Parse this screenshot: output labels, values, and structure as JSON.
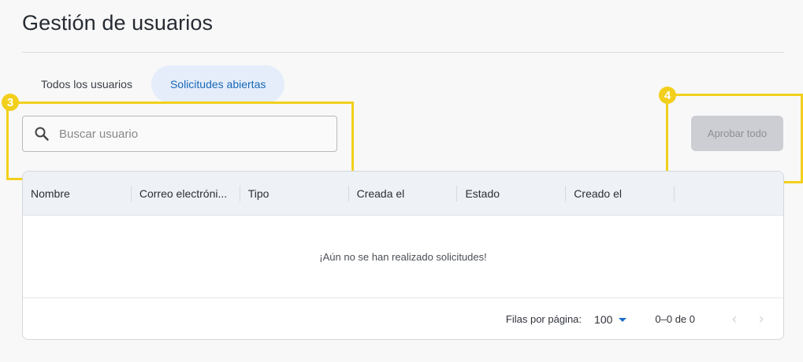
{
  "header": {
    "title": "Gestión de usuarios"
  },
  "tabs": [
    {
      "label": "Todos los usuarios",
      "active": false
    },
    {
      "label": "Solicitudes abiertas",
      "active": true
    }
  ],
  "search": {
    "placeholder": "Buscar usuario",
    "value": "",
    "icon": "search-icon"
  },
  "actions": {
    "approve_all_label": "Aprobar todo",
    "approve_all_disabled": true
  },
  "annotations": {
    "badge_3": "3",
    "badge_4": "4",
    "highlight_color": "#f2d01b"
  },
  "table": {
    "columns": [
      "Nombre",
      "Correo electróni...",
      "Tipo",
      "Creada el",
      "Estado",
      "Creado el",
      ""
    ],
    "empty_message": "¡Aún no se han realizado solicitudes!",
    "footer": {
      "rows_per_page_label": "Filas por página:",
      "rows_per_page_value": "100",
      "range": "0–0 de 0",
      "prev_icon": "chevron-left-icon",
      "next_icon": "chevron-right-icon"
    }
  },
  "colors": {
    "accent": "#1868b7",
    "tab_active_bg": "#e5edfb",
    "button_disabled_bg": "#ccced3"
  }
}
